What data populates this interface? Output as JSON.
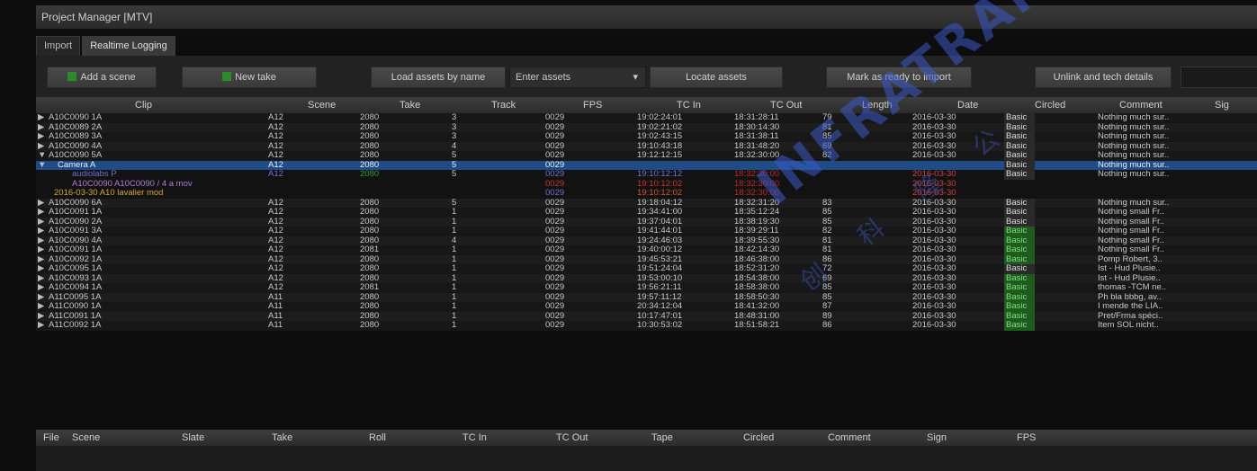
{
  "window": {
    "title": "Project Manager  [MTV]"
  },
  "tabs": [
    {
      "label": "Import"
    },
    {
      "label": "Realtime Logging"
    }
  ],
  "toolbar": {
    "add_scene": "Add a scene",
    "new_take": "New take",
    "load_assets": "Load assets by name",
    "combo_value": "Enter assets",
    "locate_assets": "Locate assets",
    "mark_assets": "Mark as ready to import",
    "link_label": "Unlink and tech details",
    "field_value": ""
  },
  "columns": [
    "Clip",
    "Scene",
    "Take",
    "Track",
    "FPS",
    "TC In",
    "TC Out",
    "Length",
    "Date",
    "Circled",
    "Comment",
    "Sig"
  ],
  "footer_columns": [
    "File",
    "Scene",
    "Slate",
    "Take",
    "Roll",
    "TC In",
    "TC Out",
    "Tape",
    "Circled",
    "Comment",
    "Sign",
    "FPS"
  ],
  "rows": [
    {
      "exp": "▶",
      "clip": "A10C0090 1A",
      "scene": "A12",
      "take": "2080",
      "track": "3",
      "fps": "0029",
      "tcin": "19:02:24:01",
      "tcout": "18:31:28:11",
      "len": "79",
      "date": "2016-03-30",
      "circled": "Basic",
      "ctype": "b",
      "comment": "Nothing much sur.."
    },
    {
      "exp": "▶",
      "clip": "A10C0089 2A",
      "scene": "A12",
      "take": "2080",
      "track": "3",
      "fps": "0029",
      "tcin": "19:02:21:02",
      "tcout": "18:30:14:30",
      "len": "81",
      "date": "2016-03-30",
      "circled": "Basic",
      "ctype": "b",
      "comment": "Nothing much sur.."
    },
    {
      "exp": "▶",
      "clip": "A10C0089 3A",
      "scene": "A12",
      "take": "2080",
      "track": "3",
      "fps": "0029",
      "tcin": "19:02:43:15",
      "tcout": "18:31:38:11",
      "len": "85",
      "date": "2016-03-30",
      "circled": "Basic",
      "ctype": "b",
      "comment": "Nothing much sur.."
    },
    {
      "exp": "▶",
      "clip": "A10C0090 4A",
      "scene": "A12",
      "take": "2080",
      "track": "4",
      "fps": "0029",
      "tcin": "19:10:43:18",
      "tcout": "18:31:48:20",
      "len": "69",
      "date": "2016-03-30",
      "circled": "Basic",
      "ctype": "b",
      "comment": "Nothing much sur.."
    },
    {
      "exp": "▼",
      "clip": "A10C0090 5A",
      "scene": "A12",
      "take": "2080",
      "track": "5",
      "fps": "0029",
      "tcin": "19:12:12:15",
      "tcout": "18:32:30:00",
      "len": "82",
      "date": "2016-03-30",
      "circled": "Basic",
      "ctype": "b",
      "comment": "Nothing much sur.."
    },
    {
      "exp": "▼",
      "clip": "Camera A",
      "scene": "A12",
      "take": "2080",
      "track": "5",
      "fps": "0029",
      "tcin": "",
      "tcout": "",
      "len": "",
      "date": "",
      "circled": "Basic",
      "ctype": "b",
      "comment": "Nothing much sur..",
      "sel": true
    },
    {
      "exp": "",
      "clip": "audiolabs P",
      "scene": "A12",
      "take": "2080",
      "track": "5",
      "fps": "0029",
      "tcin": "19:10:12:12",
      "tcout": "18:32:30:00",
      "len": "",
      "date": "2016-03-30",
      "circled": "Basic",
      "ctype": "b",
      "comment": "Nothing much sur..",
      "sub": "v1"
    },
    {
      "exp": "",
      "clip": "A10C0090   A10C0090 / 4   a mov",
      "scene": "",
      "take": "",
      "track": "",
      "fps": "0029",
      "tcin": "19:10:12:02",
      "tcout": "18:32:30:00",
      "len": "",
      "date": "2016-03-30",
      "circled": "",
      "ctype": "",
      "comment": "",
      "sub": "v2"
    },
    {
      "exp": "",
      "clip": "2016-03-30 A10         lavalier mod",
      "scene": "",
      "take": "",
      "track": "",
      "fps": "0029",
      "tcin": "19:10:12:02",
      "tcout": "18:32:30:00",
      "len": "",
      "date": "2016-03-30",
      "circled": "",
      "ctype": "",
      "comment": "",
      "sub": "v3"
    },
    {
      "exp": "▶",
      "clip": "A10C0090 6A",
      "scene": "A12",
      "take": "2080",
      "track": "5",
      "fps": "0029",
      "tcin": "19:18:04:12",
      "tcout": "18:32:31:20",
      "len": "83",
      "date": "2016-03-30",
      "circled": "Basic",
      "ctype": "b",
      "comment": "Nothing much sur.."
    },
    {
      "exp": "▶",
      "clip": "A10C0091 1A",
      "scene": "A12",
      "take": "2080",
      "track": "1",
      "fps": "0029",
      "tcin": "19:34:41:00",
      "tcout": "18:35:12:24",
      "len": "85",
      "date": "2016-03-30",
      "circled": "Basic",
      "ctype": "b",
      "comment": "Nothing small Fr.."
    },
    {
      "exp": "▶",
      "clip": "A10C0090 2A",
      "scene": "A12",
      "take": "2080",
      "track": "1",
      "fps": "0029",
      "tcin": "19:37:04:01",
      "tcout": "18:38:19:30",
      "len": "85",
      "date": "2016-03-30",
      "circled": "Basic",
      "ctype": "b",
      "comment": "Nothing small Fr.."
    },
    {
      "exp": "▶",
      "clip": "A10C0091 3A",
      "scene": "A12",
      "take": "2080",
      "track": "1",
      "fps": "0029",
      "tcin": "19:41:44:01",
      "tcout": "18:39:29:11",
      "len": "82",
      "date": "2016-03-30",
      "circled": "Basic",
      "ctype": "g",
      "comment": "Nothing small Fr.."
    },
    {
      "exp": "▶",
      "clip": "A10C0090 4A",
      "scene": "A12",
      "take": "2080",
      "track": "4",
      "fps": "0029",
      "tcin": "19:24:46:03",
      "tcout": "18:39:55:30",
      "len": "81",
      "date": "2016-03-30",
      "circled": "Basic",
      "ctype": "g",
      "comment": "Nothing small Fr.."
    },
    {
      "exp": "▶",
      "clip": "A10C0091 1A",
      "scene": "A12",
      "take": "2081",
      "track": "1",
      "fps": "0029",
      "tcin": "19:40:00:12",
      "tcout": "18:42:14:30",
      "len": "81",
      "date": "2016-03-30",
      "circled": "Basic",
      "ctype": "g",
      "comment": "Nothing small Fr.."
    },
    {
      "exp": "▶",
      "clip": "A10C0092 1A",
      "scene": "A12",
      "take": "2080",
      "track": "1",
      "fps": "0029",
      "tcin": "19:45:53:21",
      "tcout": "18:46:38:00",
      "len": "86",
      "date": "2016-03-30",
      "circled": "Basic",
      "ctype": "g",
      "comment": "Pomp Robert, 3.."
    },
    {
      "exp": "▶",
      "clip": "A10C0095 1A",
      "scene": "A12",
      "take": "2080",
      "track": "1",
      "fps": "0029",
      "tcin": "19:51:24:04",
      "tcout": "18:52:31:20",
      "len": "72",
      "date": "2016-03-30",
      "circled": "Basic",
      "ctype": "b",
      "comment": "Ist - Hud Plusie.."
    },
    {
      "exp": "▶",
      "clip": "A10C0093 1A",
      "scene": "A12",
      "take": "2080",
      "track": "1",
      "fps": "0029",
      "tcin": "19:53:00:10",
      "tcout": "18:54:38:00",
      "len": "69",
      "date": "2016-03-30",
      "circled": "Basic",
      "ctype": "g",
      "comment": "Ist - Hud Plusie.."
    },
    {
      "exp": "▶",
      "clip": "A10C0094 1A",
      "scene": "A12",
      "take": "2081",
      "track": "1",
      "fps": "0029",
      "tcin": "19:56:21:11",
      "tcout": "18:58:38:00",
      "len": "85",
      "date": "2016-03-30",
      "circled": "Basic",
      "ctype": "g",
      "comment": "thomas -TCM ne.."
    },
    {
      "exp": "▶",
      "clip": "A11C0095 1A",
      "scene": "A11",
      "take": "2080",
      "track": "1",
      "fps": "0029",
      "tcin": "19:57:11:12",
      "tcout": "18:58:50:30",
      "len": "85",
      "date": "2016-03-30",
      "circled": "Basic",
      "ctype": "g",
      "comment": "Ph bla bbbg, av.."
    },
    {
      "exp": "▶",
      "clip": "A11C0090 1A",
      "scene": "A11",
      "take": "2080",
      "track": "1",
      "fps": "0029",
      "tcin": "20:34:12:04",
      "tcout": "18:41:32:00",
      "len": "87",
      "date": "2016-03-30",
      "circled": "Basic",
      "ctype": "g",
      "comment": "I mende the LIA.."
    },
    {
      "exp": "▶",
      "clip": "A11C0091 1A",
      "scene": "A11",
      "take": "2080",
      "track": "1",
      "fps": "0029",
      "tcin": "10:17:47:01",
      "tcout": "18:48:31:00",
      "len": "89",
      "date": "2016-03-30",
      "circled": "Basic",
      "ctype": "g",
      "comment": "Pret/Frma spéci.."
    },
    {
      "exp": "▶",
      "clip": "A11C0092 1A",
      "scene": "A11",
      "take": "2080",
      "track": "1",
      "fps": "0029",
      "tcin": "10:30:53:02",
      "tcout": "18:51:58:21",
      "len": "86",
      "date": "2016-03-30",
      "circled": "Basic",
      "ctype": "g",
      "comment": "Item SOL nicht.."
    }
  ],
  "watermark": {
    "text": "INFRATRANS",
    "cn": "创 科 隆 公"
  }
}
